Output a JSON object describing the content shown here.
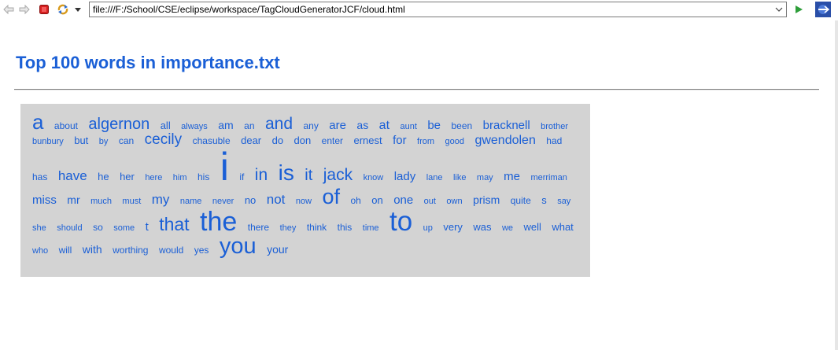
{
  "toolbar": {
    "url": "file:///F:/School/CSE/eclipse/workspace/TagCloudGeneratorJCF/cloud.html",
    "icons": [
      "back-icon",
      "forward-icon",
      "stop-icon",
      "refresh-icon",
      "chevron-down-icon",
      "go-icon",
      "eclipse-icon"
    ]
  },
  "page": {
    "title": "Top 100 words in importance.txt"
  },
  "colors": {
    "word": "#1a5fd6",
    "cloud_bg": "#d3d3d3",
    "stop": "#d62020",
    "go": "#2e9e3a"
  },
  "cloud": {
    "words": [
      {
        "text": "a",
        "size": 26
      },
      {
        "text": "about",
        "size": 12
      },
      {
        "text": "algernon",
        "size": 20
      },
      {
        "text": "all",
        "size": 13
      },
      {
        "text": "always",
        "size": 11
      },
      {
        "text": "am",
        "size": 14
      },
      {
        "text": "an",
        "size": 12
      },
      {
        "text": "and",
        "size": 21
      },
      {
        "text": "any",
        "size": 12
      },
      {
        "text": "are",
        "size": 15
      },
      {
        "text": "as",
        "size": 14
      },
      {
        "text": "at",
        "size": 16
      },
      {
        "text": "aunt",
        "size": 11
      },
      {
        "text": "be",
        "size": 15
      },
      {
        "text": "been",
        "size": 12
      },
      {
        "text": "bracknell",
        "size": 15
      },
      {
        "text": "brother",
        "size": 11
      },
      {
        "text": "bunbury",
        "size": 11
      },
      {
        "text": "but",
        "size": 13
      },
      {
        "text": "by",
        "size": 11
      },
      {
        "text": "can",
        "size": 12
      },
      {
        "text": "cecily",
        "size": 19
      },
      {
        "text": "chasuble",
        "size": 12
      },
      {
        "text": "dear",
        "size": 13
      },
      {
        "text": "do",
        "size": 13
      },
      {
        "text": "don",
        "size": 13
      },
      {
        "text": "enter",
        "size": 12
      },
      {
        "text": "ernest",
        "size": 13
      },
      {
        "text": "for",
        "size": 15
      },
      {
        "text": "from",
        "size": 11
      },
      {
        "text": "good",
        "size": 11
      },
      {
        "text": "gwendolen",
        "size": 16
      },
      {
        "text": "had",
        "size": 12
      },
      {
        "text": "has",
        "size": 12
      },
      {
        "text": "have",
        "size": 17
      },
      {
        "text": "he",
        "size": 13
      },
      {
        "text": "her",
        "size": 13
      },
      {
        "text": "here",
        "size": 11
      },
      {
        "text": "him",
        "size": 11
      },
      {
        "text": "his",
        "size": 12
      },
      {
        "text": "i",
        "size": 50
      },
      {
        "text": "if",
        "size": 12
      },
      {
        "text": "in",
        "size": 21
      },
      {
        "text": "is",
        "size": 28
      },
      {
        "text": "it",
        "size": 20
      },
      {
        "text": "jack",
        "size": 21
      },
      {
        "text": "know",
        "size": 11
      },
      {
        "text": "lady",
        "size": 15
      },
      {
        "text": "lane",
        "size": 11
      },
      {
        "text": "like",
        "size": 11
      },
      {
        "text": "may",
        "size": 11
      },
      {
        "text": "me",
        "size": 15
      },
      {
        "text": "merriman",
        "size": 11
      },
      {
        "text": "miss",
        "size": 15
      },
      {
        "text": "mr",
        "size": 14
      },
      {
        "text": "much",
        "size": 11
      },
      {
        "text": "must",
        "size": 11
      },
      {
        "text": "my",
        "size": 17
      },
      {
        "text": "name",
        "size": 11
      },
      {
        "text": "never",
        "size": 11
      },
      {
        "text": "no",
        "size": 13
      },
      {
        "text": "not",
        "size": 17
      },
      {
        "text": "now",
        "size": 11
      },
      {
        "text": "of",
        "size": 27
      },
      {
        "text": "oh",
        "size": 12
      },
      {
        "text": "on",
        "size": 13
      },
      {
        "text": "one",
        "size": 15
      },
      {
        "text": "out",
        "size": 11
      },
      {
        "text": "own",
        "size": 11
      },
      {
        "text": "prism",
        "size": 14
      },
      {
        "text": "quite",
        "size": 12
      },
      {
        "text": "s",
        "size": 13
      },
      {
        "text": "say",
        "size": 11
      },
      {
        "text": "she",
        "size": 11
      },
      {
        "text": "should",
        "size": 11
      },
      {
        "text": "so",
        "size": 12
      },
      {
        "text": "some",
        "size": 11
      },
      {
        "text": "t",
        "size": 15
      },
      {
        "text": "that",
        "size": 23
      },
      {
        "text": "the",
        "size": 34
      },
      {
        "text": "there",
        "size": 12
      },
      {
        "text": "they",
        "size": 11
      },
      {
        "text": "think",
        "size": 12
      },
      {
        "text": "this",
        "size": 12
      },
      {
        "text": "time",
        "size": 11
      },
      {
        "text": "to",
        "size": 35
      },
      {
        "text": "up",
        "size": 11
      },
      {
        "text": "very",
        "size": 13
      },
      {
        "text": "was",
        "size": 13
      },
      {
        "text": "we",
        "size": 11
      },
      {
        "text": "well",
        "size": 13
      },
      {
        "text": "what",
        "size": 13
      },
      {
        "text": "who",
        "size": 11
      },
      {
        "text": "will",
        "size": 12
      },
      {
        "text": "with",
        "size": 14
      },
      {
        "text": "worthing",
        "size": 12
      },
      {
        "text": "would",
        "size": 12
      },
      {
        "text": "yes",
        "size": 12
      },
      {
        "text": "you",
        "size": 29
      },
      {
        "text": "your",
        "size": 14
      }
    ]
  }
}
